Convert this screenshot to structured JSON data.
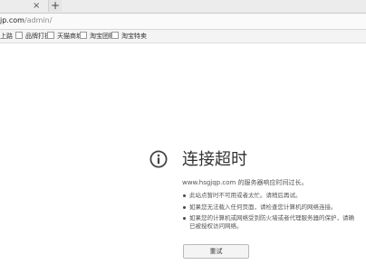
{
  "tabstrip": {
    "close_glyph": "×",
    "new_tab_glyph": "+"
  },
  "addressbar": {
    "url_host": "jp.com",
    "url_path": "/admin/"
  },
  "bookmarks": [
    {
      "label": "上路"
    },
    {
      "label": "品牌打折"
    },
    {
      "label": "天猫商城"
    },
    {
      "label": "淘宝团购"
    },
    {
      "label": "淘宝特卖"
    }
  ],
  "error": {
    "icon": "info-icon",
    "title": "连接超时",
    "description": "www.hsgjqp.com 的服务器响应时间过长。",
    "suggestions": [
      {
        "lines": [
          "此站点暂时不可用或者太忙。请稍后再试。"
        ]
      },
      {
        "lines": [
          "如果您无法载入任何页面，请检查您计算机的网络连接。"
        ]
      },
      {
        "lines": [
          "如果您的计算机或网络受到防火墙或者代理服务器的保护，请确",
          "已被授权访问网络。"
        ]
      }
    ],
    "retry_label": "重试"
  }
}
